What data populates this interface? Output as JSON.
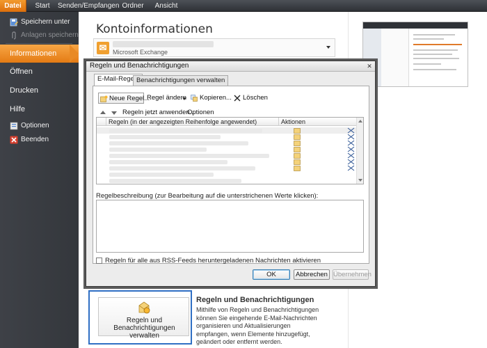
{
  "ribbon": {
    "tabs": [
      {
        "label": "Datei"
      },
      {
        "label": "Start"
      },
      {
        "label": "Senden/Empfangen"
      },
      {
        "label": "Ordner"
      },
      {
        "label": "Ansicht"
      }
    ]
  },
  "backstage": {
    "items": {
      "save_as": "Speichern unter",
      "save_attachments": "Anlagen speichern",
      "info": "Informationen",
      "open": "Öffnen",
      "print": "Drucken",
      "help": "Hilfe",
      "options": "Optionen",
      "exit": "Beenden"
    }
  },
  "main": {
    "title": "Kontoinformationen",
    "account_type": "Microsoft Exchange"
  },
  "rules_section": {
    "button_line1": "Regeln und",
    "button_line2": "Benachrichtigungen verwalten",
    "title": "Regeln und Benachrichtigungen",
    "description": "Mithilfe von Regeln und Benachrichtigungen können Sie eingehende E-Mail-Nachrichten organisieren und Aktualisierungen empfangen, wenn Elemente hinzugefügt, geändert oder entfernt werden."
  },
  "dialog": {
    "title": "Regeln und Benachrichtigungen",
    "close_glyph": "✕",
    "tabs": {
      "email_rules": "E-Mail-Regeln",
      "manage_alerts": "Benachrichtigungen verwalten"
    },
    "toolbar": {
      "new_rule": "Neue Regel...",
      "change_rule": "Regel ändern",
      "copy": "Kopieren...",
      "delete": "Löschen"
    },
    "toolbar2": {
      "apply_now": "Regeln jetzt anwenden...",
      "options": "Optionen"
    },
    "list": {
      "col_rules": "Regeln (in der angezeigten Reihenfolge angewendet)",
      "col_actions": "Aktionen"
    },
    "description_label": "Regelbeschreibung (zur Bearbeitung auf die unterstrichenen Werte klicken):",
    "rss_checkbox_label": "Regeln für alle aus RSS-Feeds heruntergeladenen Nachrichten aktivieren",
    "buttons": {
      "ok": "OK",
      "cancel": "Abbrechen",
      "apply": "Übernehmen"
    }
  },
  "colors": {
    "accent_orange": "#e98a24",
    "highlight_blue": "#2f6fc4",
    "backstage_dark": "#3e4147"
  }
}
